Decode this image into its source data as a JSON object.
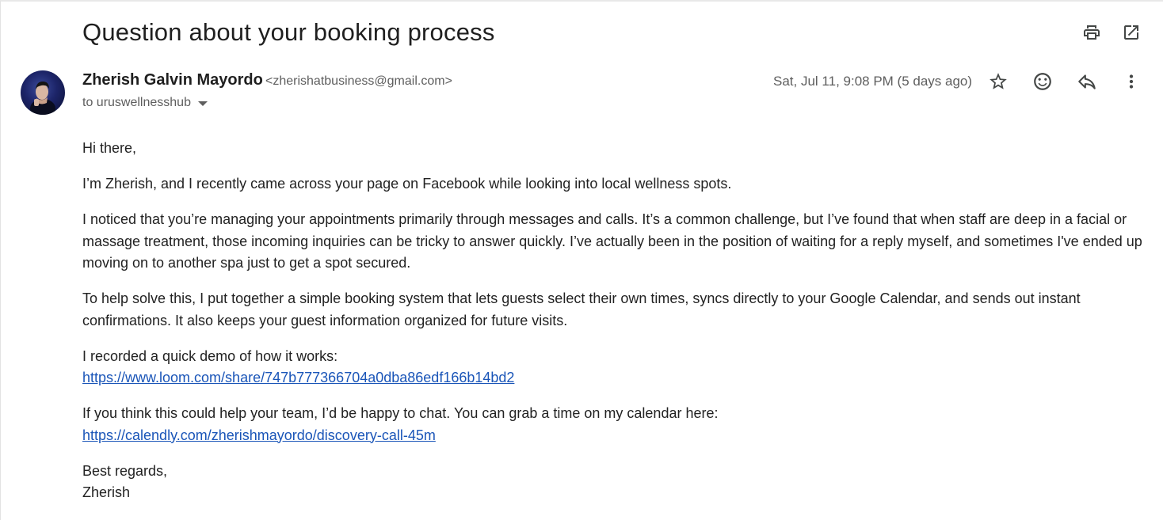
{
  "email": {
    "subject": "Question about your booking process",
    "sender_name": "Zherish Galvin Mayordo",
    "sender_email": "<zherishatbusiness@gmail.com>",
    "to_line": "to uruswellnesshub",
    "date": "Sat, Jul 11, 9:08 PM (5 days ago)",
    "body": {
      "greeting": "Hi there,",
      "p1": "I’m Zherish, and I recently came across your page on Facebook while looking into local wellness spots.",
      "p2": "I noticed that you’re managing your appointments primarily through messages and calls. It’s a common challenge, but I’ve found that when staff are deep in a facial or massage treatment, those incoming inquiries can be tricky to answer quickly. I’ve actually been in the position of waiting for a reply myself, and sometimes I've ended up moving on to another spa just to get a spot secured.",
      "p3": "To help solve this, I put together a simple booking system that lets guests select their own times, syncs directly to your Google Calendar, and sends out instant confirmations. It also keeps your guest information organized for future visits.",
      "demo_intro": "I recorded a quick demo of how it works:",
      "demo_link": "https://www.loom.com/share/747b777366704a0dba86edf166b14bd2",
      "calendar_intro": "If you think this could help your team, I’d be happy to chat. You can grab a time on my calendar here:",
      "calendar_link": "https://calendly.com/zherishmayordo/discovery-call-45m",
      "closing": "Best regards,",
      "signature": "Zherish"
    }
  },
  "icons": {
    "print": "print-icon",
    "open_new_window": "open-in-new-window-icon",
    "star": "star-icon",
    "emoji": "emoji-reaction-icon",
    "reply": "reply-icon",
    "more": "more-vertical-icon"
  },
  "colors": {
    "link": "#1a55b8",
    "text": "#222222",
    "muted": "#5e5e5e",
    "icon": "#444746"
  }
}
